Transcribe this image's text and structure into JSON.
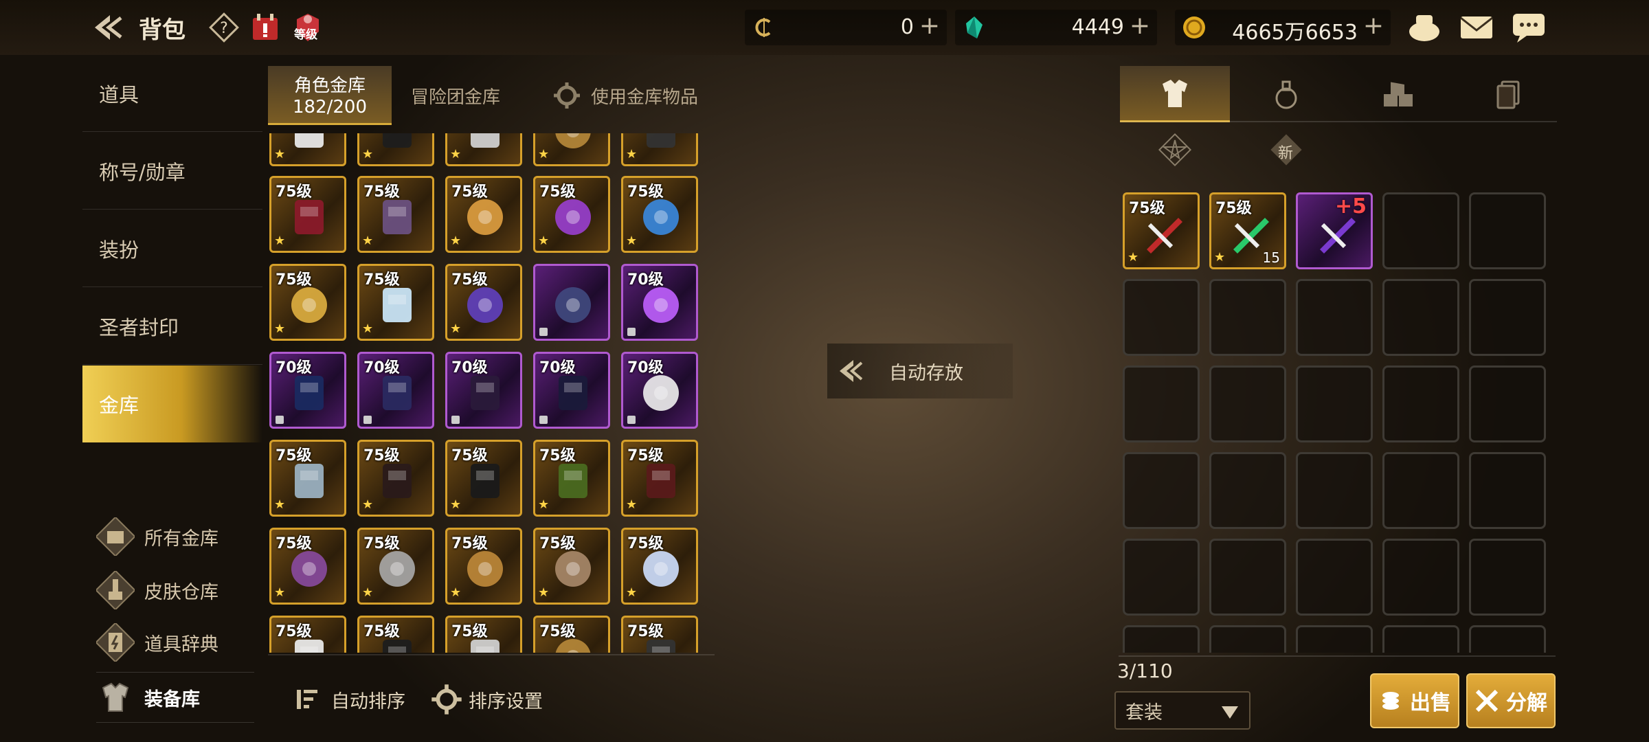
{
  "header": {
    "title": "背包",
    "level_badge": "等级"
  },
  "currency": {
    "c1": "0",
    "c2": "4449",
    "c3": "4665万6653",
    "plus": "+"
  },
  "nav": {
    "items": [
      "道具",
      "称号/勋章",
      "装扮",
      "圣者封印",
      "金库"
    ],
    "active_index": 4,
    "sub": [
      "所有金库",
      "皮肤仓库",
      "道具辞典",
      "装备库"
    ],
    "sub_selected": 3
  },
  "tabs": {
    "role_vault": "角色金库",
    "role_vault_count": "182/200",
    "adventure_vault": "冒险团金库",
    "use_vault_items": "使用金库物品"
  },
  "grid_levels": [
    [
      "",
      "",
      "",
      "",
      ""
    ],
    [
      "75级",
      "75级",
      "75级",
      "75级",
      "75级"
    ],
    [
      "75级",
      "75级",
      "75级",
      "",
      "70级"
    ],
    [
      "70级",
      "70级",
      "70级",
      "70级",
      "70级"
    ],
    [
      "75级",
      "75级",
      "75级",
      "75级",
      "75级"
    ],
    [
      "75级",
      "75级",
      "75级",
      "75级",
      "75级"
    ],
    [
      "75级",
      "75级",
      "75级",
      "75级",
      "75级"
    ]
  ],
  "auto_store": "自动存放",
  "bottom": {
    "auto_sort": "自动排序",
    "sort_settings": "排序设置"
  },
  "right": {
    "items": [
      {
        "level": "75级"
      },
      {
        "level": "75级",
        "count": "15"
      },
      {
        "plus": "+5"
      }
    ],
    "new_badge": "新",
    "count": "3/110",
    "filter": "套装",
    "sell": "出售",
    "disassemble": "分解"
  }
}
